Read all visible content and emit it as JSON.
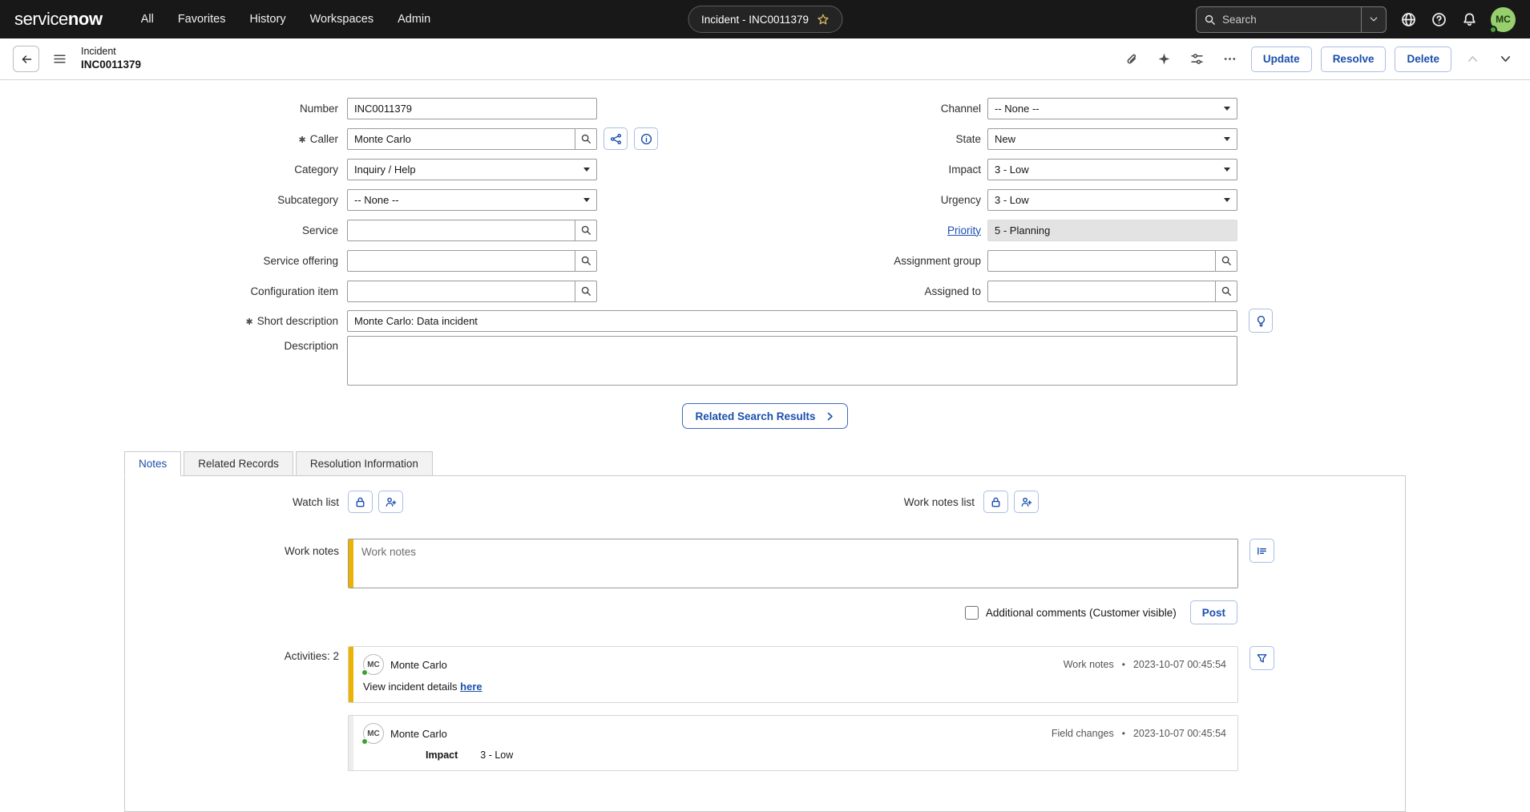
{
  "ui": {
    "required_marker": "✱",
    "bullet": "•",
    "accent_color": "#1b4fad",
    "work_notes_stripe_color": "#ecb303",
    "header_bg_color": "#181818"
  },
  "header": {
    "logo_service": "service",
    "logo_now": "now",
    "nav": [
      "All",
      "Favorites",
      "History",
      "Workspaces",
      "Admin"
    ],
    "context_pill": "Incident - INC0011379",
    "search_placeholder": "Search",
    "avatar_initials": "MC"
  },
  "form_header": {
    "record_type": "Incident",
    "record_number": "INC0011379",
    "update_label": "Update",
    "resolve_label": "Resolve",
    "delete_label": "Delete"
  },
  "form": {
    "number": {
      "label": "Number",
      "value": "INC0011379"
    },
    "caller": {
      "label": "Caller",
      "value": "Monte Carlo"
    },
    "category": {
      "label": "Category",
      "value": "Inquiry / Help"
    },
    "subcategory": {
      "label": "Subcategory",
      "value": "-- None --"
    },
    "service": {
      "label": "Service",
      "value": ""
    },
    "service_offering": {
      "label": "Service offering",
      "value": ""
    },
    "configuration_item": {
      "label": "Configuration item",
      "value": ""
    },
    "short_description": {
      "label": "Short description",
      "value": "Monte Carlo: Data incident"
    },
    "description": {
      "label": "Description",
      "value": ""
    },
    "channel": {
      "label": "Channel",
      "value": "-- None --"
    },
    "state": {
      "label": "State",
      "value": "New"
    },
    "impact": {
      "label": "Impact",
      "value": "3 - Low"
    },
    "urgency": {
      "label": "Urgency",
      "value": "3 - Low"
    },
    "priority": {
      "label": "Priority",
      "value": "5 - Planning"
    },
    "assignment_group": {
      "label": "Assignment group",
      "value": ""
    },
    "assigned_to": {
      "label": "Assigned to",
      "value": ""
    }
  },
  "related_search_label": "Related Search Results",
  "tabs": [
    "Notes",
    "Related Records",
    "Resolution Information"
  ],
  "notes": {
    "watch_list_label": "Watch list",
    "work_notes_list_label": "Work notes list",
    "work_notes_label": "Work notes",
    "work_notes_placeholder": "Work notes",
    "additional_comments_label": "Additional comments (Customer visible)",
    "post_label": "Post",
    "activities_label": "Activities: 2",
    "activities": [
      {
        "avatar": "MC",
        "name": "Monte Carlo",
        "type": "Work notes",
        "time": "2023-10-07 00:45:54",
        "text": "View incident details ",
        "link_text": "here"
      },
      {
        "avatar": "MC",
        "name": "Monte Carlo",
        "type": "Field changes",
        "time": "2023-10-07 00:45:54",
        "field_label": "Impact",
        "field_value": "3 - Low"
      }
    ]
  }
}
